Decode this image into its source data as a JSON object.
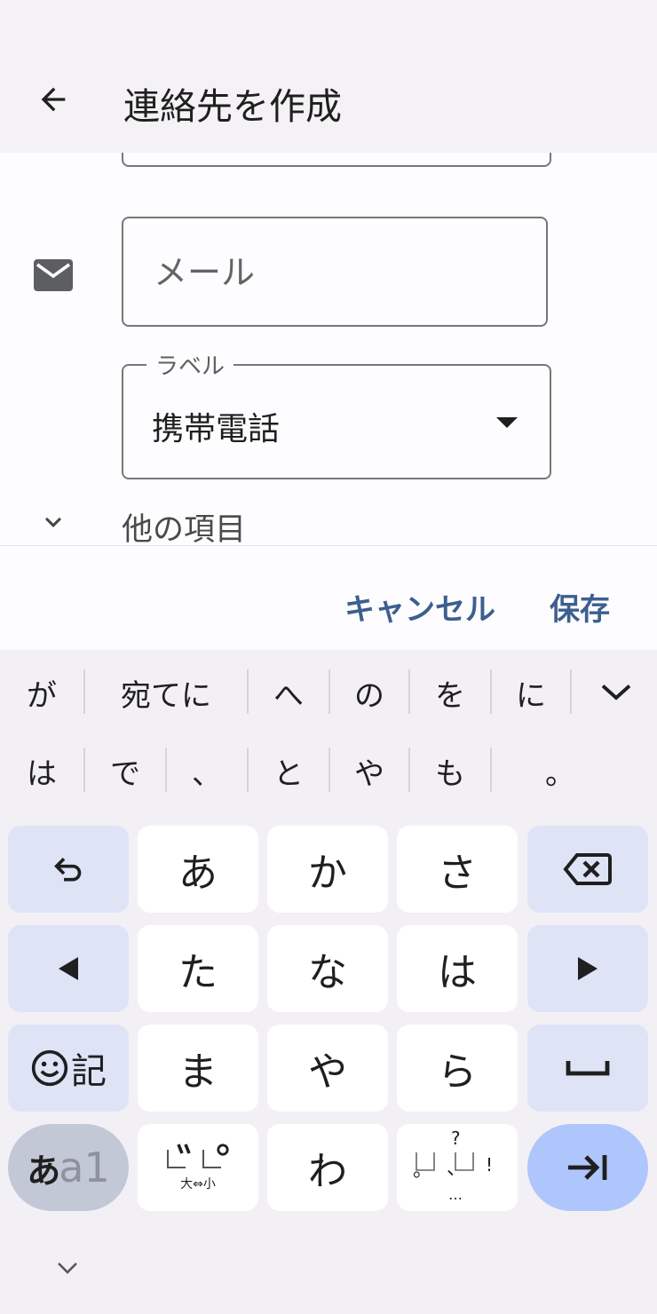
{
  "header": {
    "title": "連絡先を作成"
  },
  "form": {
    "email_placeholder": "メール",
    "label_legend": "ラベル",
    "label_value": "携帯電話",
    "more_fields": "他の項目"
  },
  "actions": {
    "cancel": "キャンセル",
    "save": "保存"
  },
  "suggestions": {
    "row1": [
      "が",
      "宛てに",
      "へ",
      "の",
      "を",
      "に"
    ],
    "row2": [
      "は",
      "で",
      "、",
      "と",
      "や",
      "も",
      "。"
    ]
  },
  "keyboard": {
    "row1": [
      "あ",
      "か",
      "さ"
    ],
    "row2": [
      "た",
      "な",
      "は"
    ],
    "row3": [
      "ま",
      "や",
      "ら"
    ],
    "emoji_symbol_label": "記",
    "mode_hira": "あ",
    "mode_latin": "a1",
    "dakuten_key_bottom": "大⇔小",
    "wa_key": "わ",
    "punct_key": {
      "top": "?",
      "left": "。",
      "mid": "、",
      "right": "!",
      "bottom": "…"
    }
  },
  "colors": {
    "accent": "#3d5f8f",
    "func_key": "#dee3f6",
    "enter_key": "#aec6fb",
    "mode_key": "#c3c8d6"
  }
}
